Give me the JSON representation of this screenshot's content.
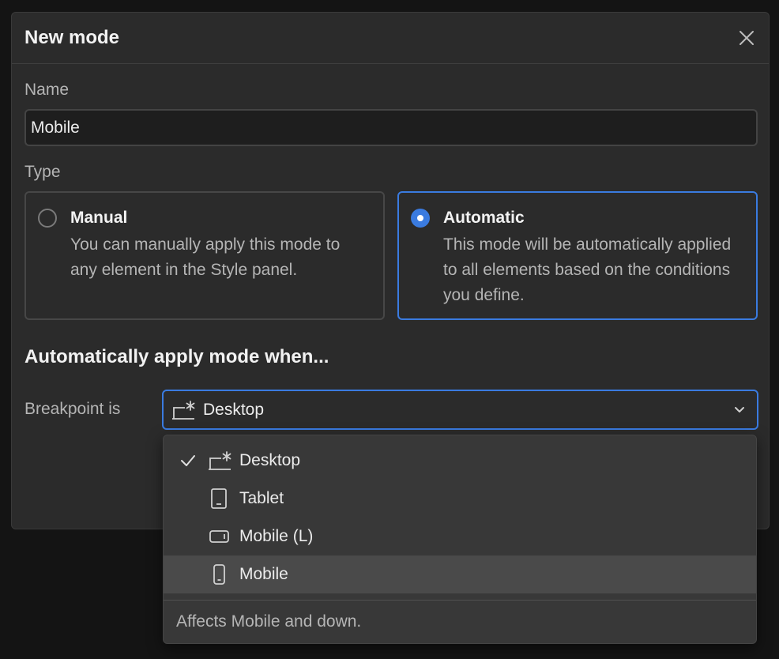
{
  "dialog": {
    "title": "New mode",
    "close_icon": "close-icon"
  },
  "name_field": {
    "label": "Name",
    "value": "Mobile"
  },
  "type": {
    "label": "Type",
    "options": [
      {
        "title": "Manual",
        "description": "You can manually apply this mode to any element in the Style panel.",
        "selected": false
      },
      {
        "title": "Automatic",
        "description": "This mode will be automatically applied to all elements based on the conditions you define.",
        "selected": true
      }
    ]
  },
  "auto_section": {
    "heading": "Automatically apply mode when...",
    "breakpoint_label": "Breakpoint is",
    "selected_value": "Desktop",
    "selected_icon": "desktop-breakpoint-icon"
  },
  "dropdown": {
    "options": [
      {
        "label": "Desktop",
        "icon": "desktop-breakpoint-icon",
        "checked": true,
        "highlighted": false
      },
      {
        "label": "Tablet",
        "icon": "tablet-icon",
        "checked": false,
        "highlighted": false
      },
      {
        "label": "Mobile (L)",
        "icon": "mobile-landscape-icon",
        "checked": false,
        "highlighted": false
      },
      {
        "label": "Mobile",
        "icon": "mobile-portrait-icon",
        "checked": false,
        "highlighted": true
      }
    ],
    "footer": "Affects Mobile and down."
  },
  "colors": {
    "accent": "#3a7be0",
    "dialog_bg": "#2b2b2b",
    "page_bg": "#141414"
  }
}
